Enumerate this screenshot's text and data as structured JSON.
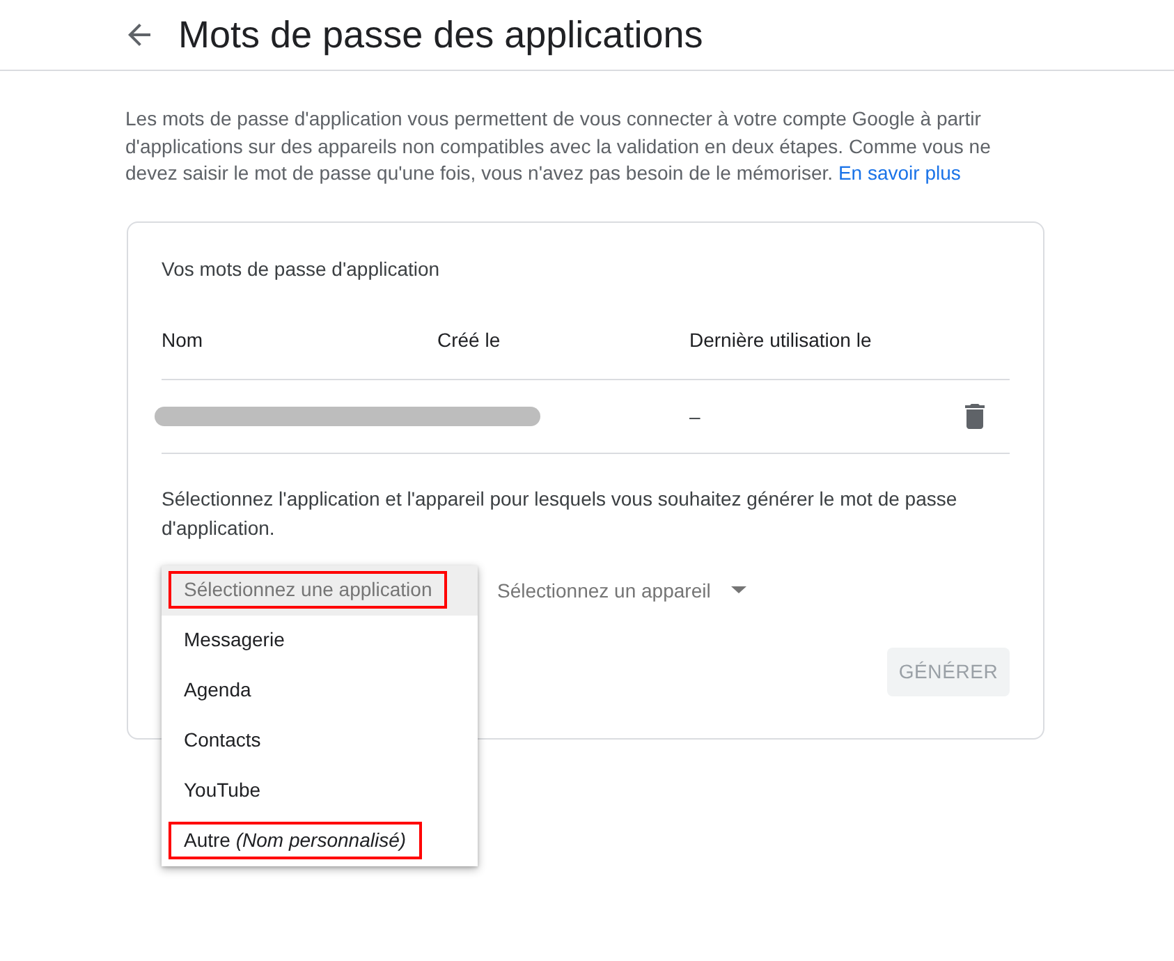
{
  "header": {
    "title": "Mots de passe des applications"
  },
  "intro": {
    "text": "Les mots de passe d'application vous permettent de vous connecter à votre compte Google à partir d'applications sur des appareils non compatibles avec la validation en deux étapes. Comme vous ne devez saisir le mot de passe qu'une fois, vous n'avez pas besoin de le mémoriser.",
    "link": "En savoir plus"
  },
  "passwords_card": {
    "title": "Vos mots de passe d'application",
    "columns": [
      "Nom",
      "Créé le",
      "Dernière utilisation le"
    ],
    "rows": [
      {
        "redacted": true,
        "last_used": "–"
      }
    ]
  },
  "generate": {
    "instructions": "Sélectionnez l'application et l'appareil pour lesquels vous souhaitez générer le mot de passe d'application.",
    "app_select": {
      "expanded": true,
      "options": [
        {
          "kind": "placeholder",
          "label": "Sélectionnez une application",
          "selected": true,
          "highlighted": true
        },
        {
          "kind": "option",
          "label": "Messagerie",
          "selected": false,
          "highlighted": false
        },
        {
          "kind": "option",
          "label": "Agenda",
          "selected": false,
          "highlighted": false
        },
        {
          "kind": "option",
          "label": "Contacts",
          "selected": false,
          "highlighted": false
        },
        {
          "kind": "option",
          "label": "YouTube",
          "selected": false,
          "highlighted": false
        },
        {
          "kind": "option",
          "label": "Autre *(Nom personnalisé)*",
          "selected": false,
          "highlighted": true
        }
      ]
    },
    "device_select": {
      "label": "Sélectionnez un appareil"
    },
    "button": {
      "label": "GÉNÉRER",
      "disabled": true
    }
  }
}
